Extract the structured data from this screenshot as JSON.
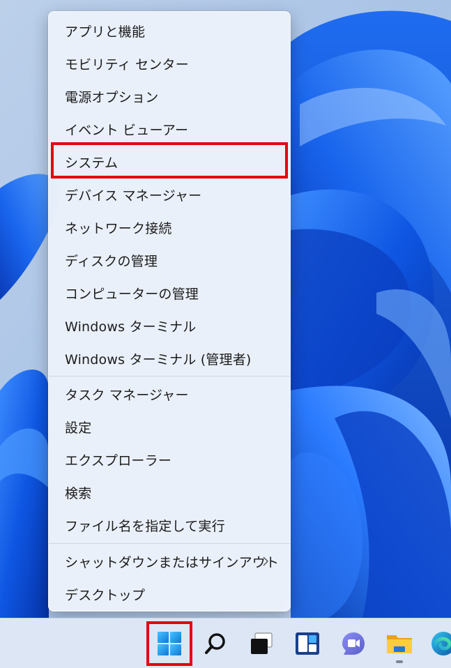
{
  "context_menu": {
    "items": [
      {
        "label": "アプリと機能"
      },
      {
        "label": "モビリティ センター"
      },
      {
        "label": "電源オプション"
      },
      {
        "label": "イベント ビューアー"
      },
      {
        "label": "システム"
      },
      {
        "label": "デバイス マネージャー"
      },
      {
        "label": "ネットワーク接続"
      },
      {
        "label": "ディスクの管理"
      },
      {
        "label": "コンピューターの管理"
      },
      {
        "label": "Windows ターミナル"
      },
      {
        "label": "Windows ターミナル (管理者)"
      },
      {
        "label": "タスク マネージャー"
      },
      {
        "label": "設定"
      },
      {
        "label": "エクスプローラー"
      },
      {
        "label": "検索"
      },
      {
        "label": "ファイル名を指定して実行"
      },
      {
        "label": "シャットダウンまたはサインアウト"
      },
      {
        "label": "デスクトップ"
      }
    ],
    "highlighted_item": "システム"
  },
  "taskbar": {
    "icons": [
      {
        "name": "windows-start-icon"
      },
      {
        "name": "search-icon"
      },
      {
        "name": "task-view-icon"
      },
      {
        "name": "widgets-icon"
      },
      {
        "name": "teams-chat-icon"
      },
      {
        "name": "file-explorer-icon"
      },
      {
        "name": "edge-icon"
      }
    ]
  },
  "colors": {
    "highlight_border": "#e60012",
    "menu_background": "#ecf1fa",
    "wallpaper_blue": "#1a5fe0"
  }
}
